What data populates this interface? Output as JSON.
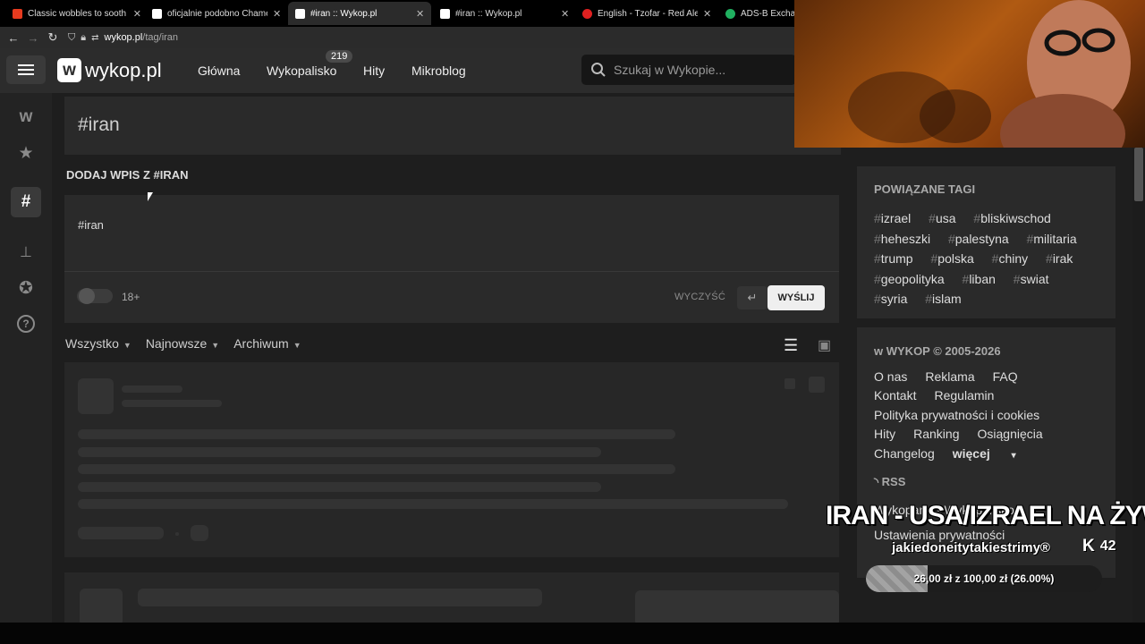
{
  "browser": {
    "tabs": [
      {
        "title": "Classic wobbles to sooth",
        "favicon_color": "#e63b1f"
      },
      {
        "title": "oficjalnie podobno Chamene",
        "favicon_color": "#ffffff"
      },
      {
        "title": "#iran :: Wykop.pl",
        "favicon_color": "#ffffff",
        "active": true
      },
      {
        "title": "#iran :: Wykop.pl",
        "favicon_color": "#ffffff"
      },
      {
        "title": "English - Tzofar - Red Alert",
        "favicon_color": "#e02020"
      },
      {
        "title": "ADS-B Exchange",
        "favicon_color": "#20b060"
      }
    ],
    "url_host": "wykop.pl",
    "url_path": "/tag/iran"
  },
  "header": {
    "logo": "wykop.pl",
    "nav": [
      "Główna",
      "Wykopalisko",
      "Hity",
      "Mikroblog"
    ],
    "badge": "219",
    "search_placeholder": "Szukaj w Wykopie..."
  },
  "page": {
    "title": "#iran",
    "add_heading": "DODAJ WPIS Z #IRAN",
    "composer_text": "#iran",
    "age_label": "18+",
    "clear_label": "WYCZYŚĆ",
    "send_label": "WYŚLIJ",
    "filters": [
      "Wszystko",
      "Najnowsze",
      "Archiwum"
    ]
  },
  "related": {
    "heading": "POWIĄZANE TAGI",
    "tags": [
      "izrael",
      "usa",
      "bliskiwschod",
      "heheszki",
      "palestyna",
      "militaria",
      "trump",
      "polska",
      "chiny",
      "irak",
      "geopolityka",
      "liban",
      "swiat",
      "syria",
      "islam"
    ]
  },
  "footer": {
    "heading": "WYKOP © 2005-2026",
    "links": [
      "O nas",
      "Reklama",
      "FAQ",
      "Kontakt",
      "Regulamin",
      "Polityka prywatności i cookies",
      "Hity",
      "Ranking",
      "Osiągnięcia",
      "Changelog",
      "więcej"
    ],
    "rss": "RSS",
    "rss_links": "Wykopane · Wykopalisko",
    "privacy": "Ustawienia prywatności"
  },
  "overlay": {
    "title": "IRAN - USA/IZRAEL NA ŻYWO",
    "channel": "jakiedoneitytakiestrimy®",
    "viewers": "42",
    "goal_text": "26,00 zł z 100,00 zł (26.00%)",
    "goal_fraction": 0.26
  }
}
